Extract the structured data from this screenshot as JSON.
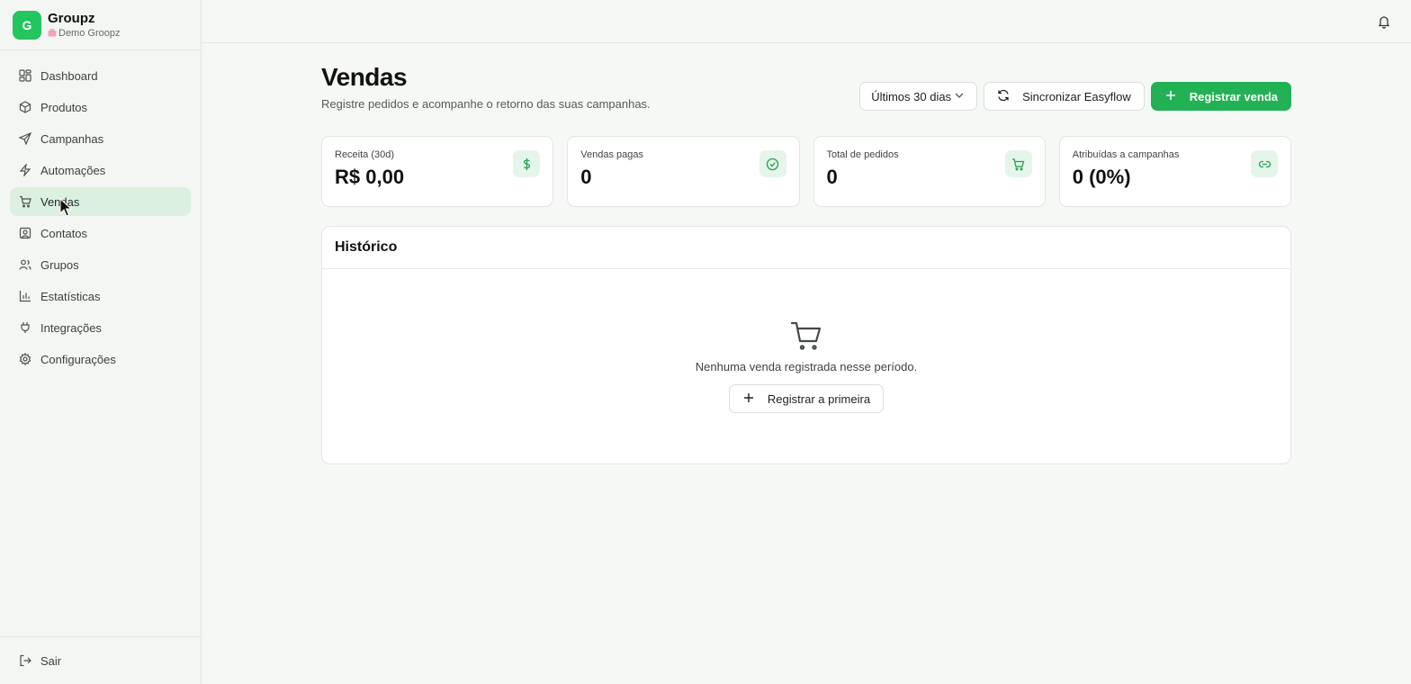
{
  "brand": {
    "logo_letter": "G",
    "name": "Groupz",
    "workspace": "Demo Groopz"
  },
  "sidebar": {
    "items": [
      {
        "label": "Dashboard",
        "icon": "layout-grid-icon"
      },
      {
        "label": "Produtos",
        "icon": "package-icon"
      },
      {
        "label": "Campanhas",
        "icon": "send-icon"
      },
      {
        "label": "Automações",
        "icon": "zap-icon"
      },
      {
        "label": "Vendas",
        "icon": "cart-icon",
        "active": true
      },
      {
        "label": "Contatos",
        "icon": "contact-icon"
      },
      {
        "label": "Grupos",
        "icon": "users-icon"
      },
      {
        "label": "Estatísticas",
        "icon": "bar-chart-icon"
      },
      {
        "label": "Integrações",
        "icon": "plug-icon"
      },
      {
        "label": "Configurações",
        "icon": "gear-icon"
      }
    ],
    "logout_label": "Sair"
  },
  "header": {
    "title": "Vendas",
    "subtitle": "Registre pedidos e acompanhe o retorno das suas campanhas.",
    "period_select": "Últimos 30 dias",
    "sync_label": "Sincronizar Easyflow",
    "register_label": "Registrar venda"
  },
  "stats": [
    {
      "label": "Receita (30d)",
      "value": "R$ 0,00",
      "icon": "dollar-icon"
    },
    {
      "label": "Vendas pagas",
      "value": "0",
      "icon": "check-circle-icon"
    },
    {
      "label": "Total de pedidos",
      "value": "0",
      "icon": "cart-icon"
    },
    {
      "label": "Atribuídas a campanhas",
      "value": "0 (0%)",
      "icon": "link-icon"
    }
  ],
  "history": {
    "title": "Histórico",
    "empty_text": "Nenhuma venda registrada nesse período.",
    "empty_button": "Registrar a primeira"
  },
  "colors": {
    "accent": "#22b155",
    "accent_soft": "#dcf0e0",
    "background": "#f6f8f5"
  }
}
